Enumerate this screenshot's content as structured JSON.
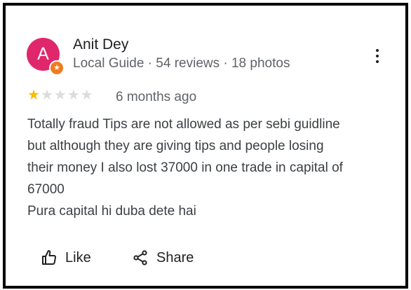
{
  "reviewer": {
    "name": "Anit Dey",
    "avatar_letter": "A",
    "badge_icon": "star-icon",
    "meta": "Local Guide · 54 reviews · 18 photos"
  },
  "rating": {
    "value": 1,
    "max": 5
  },
  "time": "6 months ago",
  "review_lines": [
    "Totally fraud Tips are not allowed as per sebi guidline",
    "but although they are giving tips and people losing",
    "their money I also lost 37000 in one trade in capital of",
    "67000",
    "Pura capital hi duba dete hai"
  ],
  "actions": {
    "like_label": "Like",
    "share_label": "Share"
  },
  "colors": {
    "avatar": "#e0276b",
    "badge": "#f07b20",
    "star_on": "#fbbc04",
    "star_off": "#dadce0"
  }
}
